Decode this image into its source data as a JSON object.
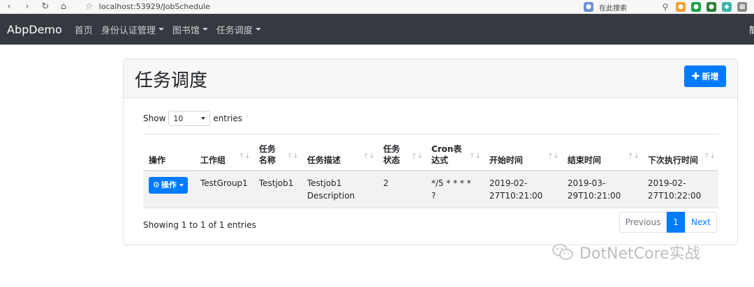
{
  "browser": {
    "url": "localhost:53929/JobSchedule",
    "search_placeholder": "在此搜索"
  },
  "navbar": {
    "brand": "AbpDemo",
    "items": [
      "首页",
      "身份认证管理",
      "图书馆",
      "任务调度"
    ],
    "user_partial": "簡"
  },
  "page": {
    "title": "任务调度",
    "add_label": "新增"
  },
  "length_menu": {
    "prefix": "Show",
    "value": "10",
    "suffix": "entries"
  },
  "table": {
    "headers": [
      [
        "操作"
      ],
      [
        "工作组"
      ],
      [
        "任务",
        "名称"
      ],
      [
        "任务描述"
      ],
      [
        "任务",
        "状态"
      ],
      [
        "Cron表",
        "达式"
      ],
      [
        "开始时间"
      ],
      [
        "结束时间"
      ],
      [
        "下次执行时间"
      ]
    ],
    "rows": [
      {
        "action_label": "操作",
        "group": "TestGroup1",
        "name": "Testjob1",
        "desc": [
          "Testjob1",
          "Description"
        ],
        "status": "2",
        "cron": "*/5 * * * * ?",
        "start": [
          "2019-02-",
          "27T10:21:00"
        ],
        "end": [
          "2019-03-",
          "29T10:21:00"
        ],
        "next": [
          "2019-02-",
          "27T10:22:00"
        ]
      }
    ]
  },
  "footer": {
    "info": "Showing 1 to 1 of 1 entries",
    "previous": "Previous",
    "page": "1",
    "next": "Next"
  },
  "watermark": "DotNetCore实战",
  "colors": {
    "primary": "#007bff",
    "navbar": "#343a40"
  }
}
